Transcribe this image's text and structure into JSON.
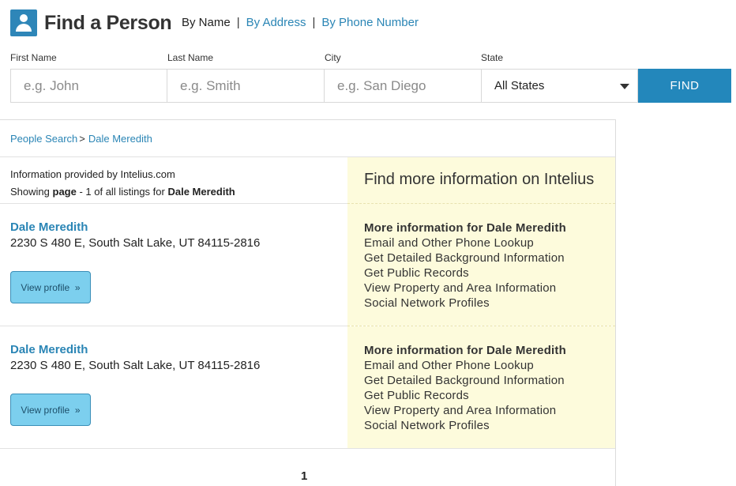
{
  "header": {
    "title": "Find a Person",
    "logo_icon": "person-icon",
    "nav": {
      "by_name": "By Name",
      "by_address": "By Address",
      "by_phone": "By Phone Number",
      "separator": "|"
    }
  },
  "search": {
    "first_name_label": "First Name",
    "first_name_placeholder": "e.g. John",
    "last_name_label": "Last Name",
    "last_name_placeholder": "e.g. Smith",
    "city_label": "City",
    "city_placeholder": "e.g. San Diego",
    "state_label": "State",
    "state_value": "All States",
    "find_label": "FIND"
  },
  "breadcrumb": {
    "root": "People Search",
    "arrow": ">",
    "current": "Dale Meredith"
  },
  "info": {
    "provided_by": "Information provided by Intelius.com",
    "showing_prefix": "Showing",
    "showing_page_word": "page",
    "showing_mid": "- 1 of all listings for",
    "showing_name": "Dale Meredith"
  },
  "promo": {
    "title": "Find more information on Intelius"
  },
  "results": [
    {
      "name": "Dale Meredith",
      "address": "2230 S 480 E, South Salt Lake, UT 84115-2816",
      "view_label": "View profile",
      "view_chevron": "»",
      "more_title": "More information for Dale Meredith",
      "more_items": [
        "Email and Other Phone Lookup",
        "Get Detailed Background Information",
        "Get Public Records",
        "View Property and Area Information",
        "Social Network Profiles"
      ]
    },
    {
      "name": "Dale Meredith",
      "address": "2230 S 480 E, South Salt Lake, UT 84115-2816",
      "view_label": "View profile",
      "view_chevron": "»",
      "more_title": "More information for Dale Meredith",
      "more_items": [
        "Email and Other Phone Lookup",
        "Get Detailed Background Information",
        "Get Public Records",
        "View Property and Area Information",
        "Social Network Profiles"
      ]
    }
  ],
  "pagination": {
    "current": "1"
  },
  "colors": {
    "accent": "#2387bb",
    "link": "#2a85b5",
    "promo_bg": "#fdfbdc",
    "view_button": "#7ccfee"
  }
}
